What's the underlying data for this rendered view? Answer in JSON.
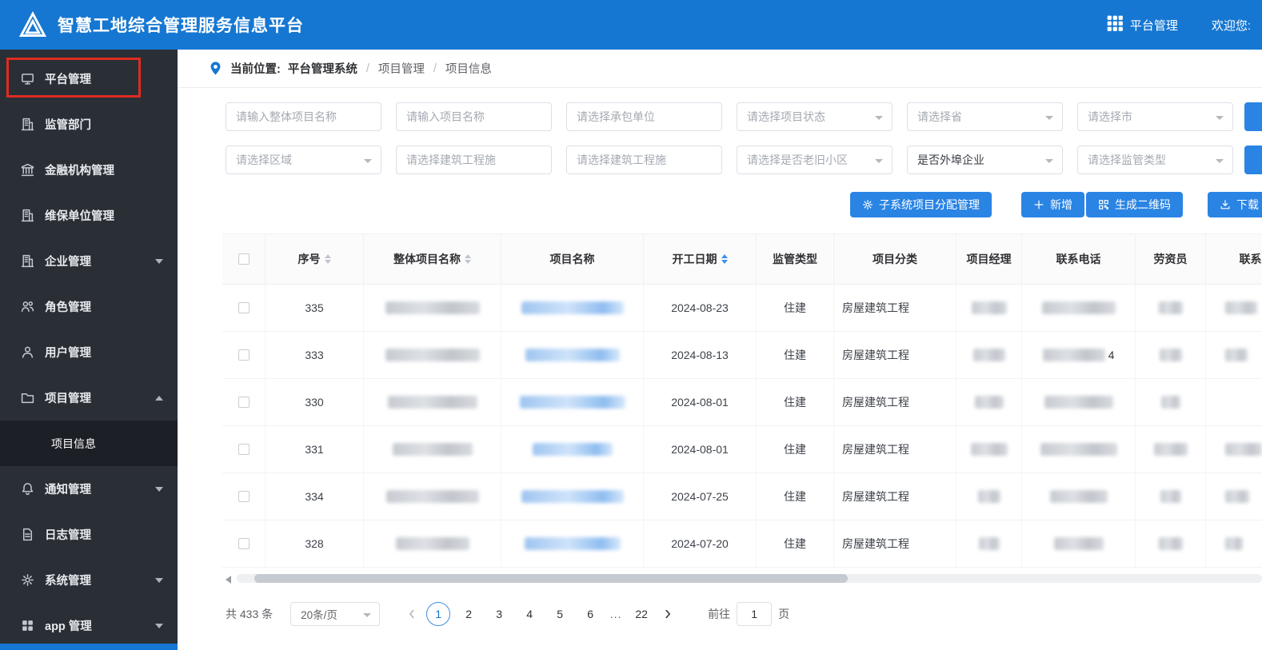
{
  "header": {
    "title": "智慧工地综合管理服务信息平台",
    "platform_label": "平台管理",
    "welcome": "欢迎您:"
  },
  "sidebar": {
    "items": [
      {
        "id": "platform",
        "label": "平台管理",
        "icon": "monitor",
        "highlight": true
      },
      {
        "id": "regulator",
        "label": "监管部门",
        "icon": "building"
      },
      {
        "id": "finance",
        "label": "金融机构管理",
        "icon": "bank"
      },
      {
        "id": "maintenance",
        "label": "维保单位管理",
        "icon": "building"
      },
      {
        "id": "enterprise",
        "label": "企业管理",
        "icon": "building",
        "caret": "down"
      },
      {
        "id": "role",
        "label": "角色管理",
        "icon": "team"
      },
      {
        "id": "user",
        "label": "用户管理",
        "icon": "user"
      },
      {
        "id": "project",
        "label": "项目管理",
        "icon": "folder",
        "caret": "up",
        "children": [
          {
            "id": "project-info",
            "label": "项目信息",
            "active": true
          }
        ]
      },
      {
        "id": "notice",
        "label": "通知管理",
        "icon": "bell",
        "caret": "down"
      },
      {
        "id": "log",
        "label": "日志管理",
        "icon": "file"
      },
      {
        "id": "system",
        "label": "系统管理",
        "icon": "gear",
        "caret": "down"
      },
      {
        "id": "app",
        "label": "app 管理",
        "icon": "grid",
        "caret": "down"
      }
    ]
  },
  "breadcrumb": {
    "label": "当前位置:",
    "items": [
      "平台管理系统",
      "项目管理",
      "项目信息"
    ]
  },
  "filters": {
    "row1": [
      {
        "type": "input",
        "placeholder": "请输入整体项目名称"
      },
      {
        "type": "input",
        "placeholder": "请输入项目名称"
      },
      {
        "type": "input",
        "placeholder": "请选择承包单位"
      },
      {
        "type": "select",
        "placeholder": "请选择项目状态"
      },
      {
        "type": "select",
        "placeholder": "请选择省"
      },
      {
        "type": "select",
        "placeholder": "请选择市"
      }
    ],
    "row2": [
      {
        "type": "select",
        "placeholder": "请选择区域"
      },
      {
        "type": "date",
        "placeholder": "请选择建筑工程施"
      },
      {
        "type": "date",
        "placeholder": "请选择建筑工程施"
      },
      {
        "type": "select",
        "placeholder": "请选择是否老旧小区"
      },
      {
        "type": "select",
        "placeholder": "是否外埠企业",
        "dark": true
      },
      {
        "type": "select",
        "placeholder": "请选择监管类型"
      }
    ]
  },
  "actions": {
    "buttons": [
      {
        "id": "subsystem-assign",
        "icon": "gear",
        "label": "子系统项目分配管理"
      },
      {
        "id": "add",
        "icon": "plus",
        "label": "新增"
      },
      {
        "id": "qrcode",
        "icon": "qr",
        "label": "生成二维码"
      },
      {
        "id": "download",
        "icon": "download",
        "label": "下载"
      }
    ]
  },
  "table": {
    "columns": [
      "序号",
      "整体项目名称",
      "项目名称",
      "开工日期",
      "监管类型",
      "项目分类",
      "项目经理",
      "联系电话",
      "劳资员",
      "联系电话"
    ],
    "rows": [
      {
        "seq": "335",
        "start_date": "2024-08-23",
        "supervision": "住建",
        "category": "房屋建筑工程"
      },
      {
        "seq": "333",
        "start_date": "2024-08-13",
        "supervision": "住建",
        "category": "房屋建筑工程",
        "phone_suffix": "4"
      },
      {
        "seq": "330",
        "start_date": "2024-08-01",
        "supervision": "住建",
        "category": "房屋建筑工程"
      },
      {
        "seq": "331",
        "start_date": "2024-08-01",
        "supervision": "住建",
        "category": "房屋建筑工程"
      },
      {
        "seq": "334",
        "start_date": "2024-07-25",
        "supervision": "住建",
        "category": "房屋建筑工程"
      },
      {
        "seq": "328",
        "start_date": "2024-07-20",
        "supervision": "住建",
        "category": "房屋建筑工程"
      }
    ]
  },
  "pagination": {
    "total": "共 433 条",
    "page_size": "20条/页",
    "pages": [
      "1",
      "2",
      "3",
      "4",
      "5",
      "6",
      "...",
      "22"
    ],
    "active_page": "1",
    "goto_label": "前往",
    "goto_value": "1",
    "goto_suffix": "页"
  }
}
